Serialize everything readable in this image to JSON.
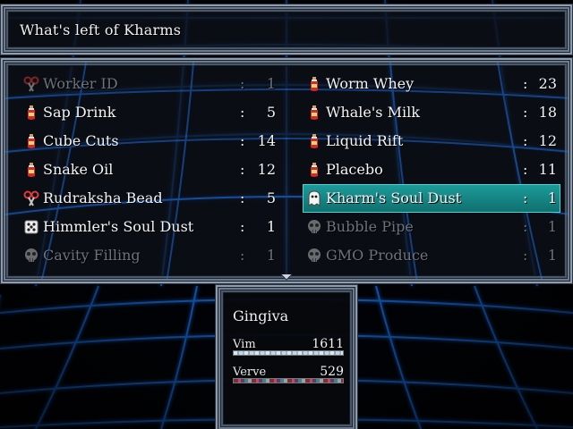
{
  "header": {
    "title": "What's left of Kharms"
  },
  "inventory": {
    "left": [
      {
        "name": "Worker ID",
        "qty": "1",
        "icon": "scissors-icon",
        "disabled": true,
        "selected": false
      },
      {
        "name": "Sap Drink",
        "qty": "5",
        "icon": "bottle-icon",
        "disabled": false,
        "selected": false
      },
      {
        "name": "Cube Cuts",
        "qty": "14",
        "icon": "bottle-icon",
        "disabled": false,
        "selected": false
      },
      {
        "name": "Snake Oil",
        "qty": "12",
        "icon": "bottle-icon",
        "disabled": false,
        "selected": false
      },
      {
        "name": "Rudraksha Bead",
        "qty": "5",
        "icon": "scissors-icon",
        "disabled": false,
        "selected": false
      },
      {
        "name": "Himmler's Soul Dust",
        "qty": "1",
        "icon": "dice-icon",
        "disabled": false,
        "selected": false
      },
      {
        "name": "Cavity Filling",
        "qty": "1",
        "icon": "skull-icon",
        "disabled": true,
        "selected": false
      }
    ],
    "right": [
      {
        "name": "Worm Whey",
        "qty": "23",
        "icon": "bottle-icon",
        "disabled": false,
        "selected": false
      },
      {
        "name": "Whale's Milk",
        "qty": "18",
        "icon": "bottle-icon",
        "disabled": false,
        "selected": false
      },
      {
        "name": "Liquid Rift",
        "qty": "12",
        "icon": "bottle-icon",
        "disabled": false,
        "selected": false
      },
      {
        "name": "Placebo",
        "qty": "11",
        "icon": "bottle-icon",
        "disabled": false,
        "selected": false
      },
      {
        "name": "Kharm's Soul Dust",
        "qty": "1",
        "icon": "ghost-icon",
        "disabled": false,
        "selected": true
      },
      {
        "name": "Bubble Pipe",
        "qty": "1",
        "icon": "skull-icon",
        "disabled": true,
        "selected": false
      },
      {
        "name": "GMO Produce",
        "qty": "1",
        "icon": "skull-icon",
        "disabled": true,
        "selected": false
      }
    ],
    "colon": ":"
  },
  "status": {
    "actor_name": "Gingiva",
    "vim": {
      "label": "Vim",
      "value": "1611",
      "fill_fraction": 1.0
    },
    "verve": {
      "label": "Verve",
      "value": "529",
      "fill_fraction": 1.0
    }
  },
  "colors": {
    "selection": "#1d9a9a",
    "text": "#f4f4f4",
    "disabled_text": "#6e737a",
    "grid_line": "#1f7cff"
  }
}
